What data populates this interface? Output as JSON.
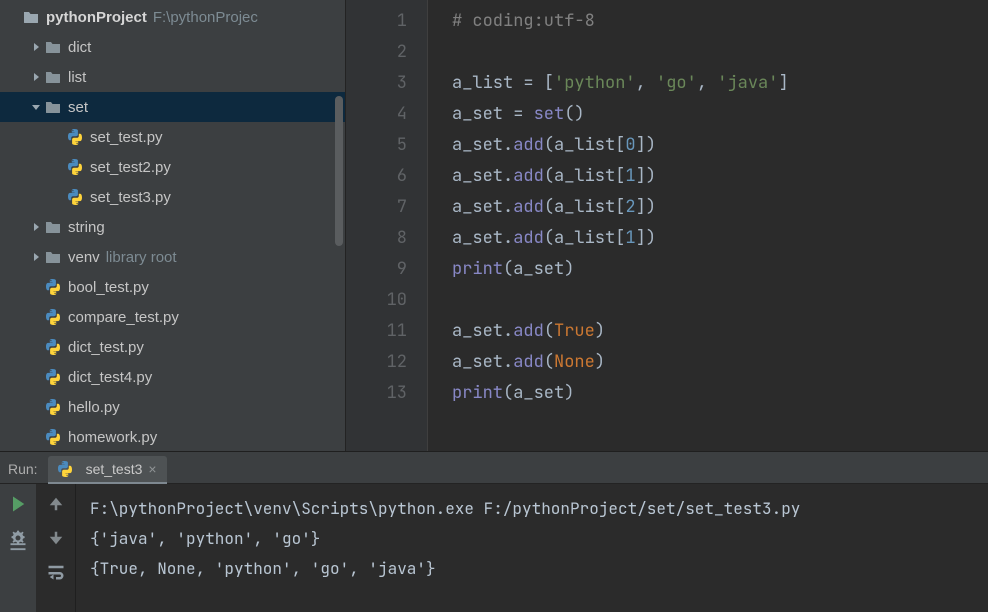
{
  "project": {
    "name": "pythonProject",
    "path": "F:\\pythonProjec",
    "tree": [
      {
        "kind": "project",
        "label": "pythonProject",
        "detail": "F:\\pythonProjec",
        "indent": 0,
        "arrow": ""
      },
      {
        "kind": "folder",
        "label": "dict",
        "indent": 1,
        "arrow": "right"
      },
      {
        "kind": "folder",
        "label": "list",
        "indent": 1,
        "arrow": "right"
      },
      {
        "kind": "folder",
        "label": "set",
        "indent": 1,
        "arrow": "down",
        "selected": true
      },
      {
        "kind": "pyfile",
        "label": "set_test.py",
        "indent": 2
      },
      {
        "kind": "pyfile",
        "label": "set_test2.py",
        "indent": 2
      },
      {
        "kind": "pyfile",
        "label": "set_test3.py",
        "indent": 2
      },
      {
        "kind": "folder",
        "label": "string",
        "indent": 1,
        "arrow": "right"
      },
      {
        "kind": "folder",
        "label": "venv",
        "detail": "library root",
        "indent": 1,
        "arrow": "right"
      },
      {
        "kind": "pyfile",
        "label": "bool_test.py",
        "indent": 1
      },
      {
        "kind": "pyfile",
        "label": "compare_test.py",
        "indent": 1
      },
      {
        "kind": "pyfile",
        "label": "dict_test.py",
        "indent": 1
      },
      {
        "kind": "pyfile",
        "label": "dict_test4.py",
        "indent": 1
      },
      {
        "kind": "pyfile",
        "label": "hello.py",
        "indent": 1
      },
      {
        "kind": "pyfile",
        "label": "homework.py",
        "indent": 1
      }
    ]
  },
  "editor": {
    "line_count": 13,
    "lines": [
      [
        {
          "t": "cmt",
          "s": "# coding:utf-8"
        }
      ],
      [],
      [
        {
          "t": "id",
          "s": "a_list "
        },
        {
          "t": "op",
          "s": "= "
        },
        {
          "t": "punc",
          "s": "["
        },
        {
          "t": "str",
          "s": "'python'"
        },
        {
          "t": "punc",
          "s": ", "
        },
        {
          "t": "str",
          "s": "'go'"
        },
        {
          "t": "punc",
          "s": ", "
        },
        {
          "t": "str",
          "s": "'java'"
        },
        {
          "t": "punc",
          "s": "]"
        }
      ],
      [
        {
          "t": "id",
          "s": "a_set "
        },
        {
          "t": "op",
          "s": "= "
        },
        {
          "t": "builtin",
          "s": "set"
        },
        {
          "t": "punc",
          "s": "()"
        }
      ],
      [
        {
          "t": "id",
          "s": "a_set"
        },
        {
          "t": "punc",
          "s": "."
        },
        {
          "t": "fn",
          "s": "add"
        },
        {
          "t": "punc",
          "s": "(a_list["
        },
        {
          "t": "num",
          "s": "0"
        },
        {
          "t": "punc",
          "s": "])"
        }
      ],
      [
        {
          "t": "id",
          "s": "a_set"
        },
        {
          "t": "punc",
          "s": "."
        },
        {
          "t": "fn",
          "s": "add"
        },
        {
          "t": "punc",
          "s": "(a_list["
        },
        {
          "t": "num",
          "s": "1"
        },
        {
          "t": "punc",
          "s": "])"
        }
      ],
      [
        {
          "t": "id",
          "s": "a_set"
        },
        {
          "t": "punc",
          "s": "."
        },
        {
          "t": "fn",
          "s": "add"
        },
        {
          "t": "punc",
          "s": "(a_list["
        },
        {
          "t": "num",
          "s": "2"
        },
        {
          "t": "punc",
          "s": "])"
        }
      ],
      [
        {
          "t": "id",
          "s": "a_set"
        },
        {
          "t": "punc",
          "s": "."
        },
        {
          "t": "fn",
          "s": "add"
        },
        {
          "t": "punc",
          "s": "(a_list["
        },
        {
          "t": "num",
          "s": "1"
        },
        {
          "t": "punc",
          "s": "])"
        }
      ],
      [
        {
          "t": "builtin",
          "s": "print"
        },
        {
          "t": "punc",
          "s": "(a_set)"
        }
      ],
      [],
      [
        {
          "t": "id",
          "s": "a_set"
        },
        {
          "t": "punc",
          "s": "."
        },
        {
          "t": "fn",
          "s": "add"
        },
        {
          "t": "punc",
          "s": "("
        },
        {
          "t": "kwc",
          "s": "True"
        },
        {
          "t": "punc",
          "s": ")"
        }
      ],
      [
        {
          "t": "id",
          "s": "a_set"
        },
        {
          "t": "punc",
          "s": "."
        },
        {
          "t": "fn",
          "s": "add"
        },
        {
          "t": "punc",
          "s": "("
        },
        {
          "t": "kwc",
          "s": "None"
        },
        {
          "t": "punc",
          "s": ")"
        }
      ],
      [
        {
          "t": "builtin",
          "s": "print"
        },
        {
          "t": "punc",
          "s": "(a_set)"
        }
      ]
    ]
  },
  "run": {
    "title": "Run:",
    "tab_label": "set_test3",
    "output": [
      "F:\\pythonProject\\venv\\Scripts\\python.exe F:/pythonProject/set/set_test3.py",
      "{'java', 'python', 'go'}",
      "{True, None, 'python', 'go', 'java'}"
    ]
  }
}
